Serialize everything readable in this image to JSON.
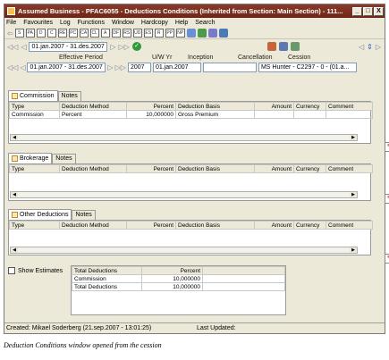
{
  "window": {
    "title": "Assumed Business - PFAC6055 - Deductions Conditions (Inherited from Section: Main Section) - 111...",
    "min_label": "_",
    "max_label": "□",
    "close_label": "X"
  },
  "menu": [
    "File",
    "Favourites",
    "Log",
    "Functions",
    "Window",
    "Hardcopy",
    "Help",
    "Search"
  ],
  "toolbar_icons": [
    "S",
    "PA",
    "D",
    "C",
    "RE",
    "PC",
    "CA",
    "CL",
    "A",
    "DF",
    "RS",
    "UD",
    "ES",
    "R",
    "PP",
    "NP"
  ],
  "navigation": {
    "period_value": "01.jan.2007 - 31.des.2007"
  },
  "contract": {
    "headers": {
      "effective_period": "Effective Period",
      "uw_yr": "U/W Yr",
      "inception": "Inception",
      "cancellation": "Cancellation",
      "cession": "Cession"
    },
    "values": {
      "effective_period": "01.jan.2007 - 31.des.2007",
      "uw_yr": "2007",
      "inception": "01.jan.2007",
      "cancellation": "",
      "cession": "MS Hunter - C2297 - 0 - (01.a..."
    }
  },
  "commission": {
    "tab": "Commission",
    "notes_tab": "Notes",
    "columns": [
      "Type",
      "Deduction Method",
      "Percent",
      "Deduction Basis",
      "Amount",
      "Currency",
      "Comment"
    ],
    "rows": [
      [
        "Commission",
        "Percent",
        "10,000000",
        "Gross Premium",
        "",
        "",
        ""
      ]
    ]
  },
  "brokerage": {
    "tab": "Brokerage",
    "notes_tab": "Notes",
    "columns": [
      "Type",
      "Deduction Method",
      "Percent",
      "Deduction Basis",
      "Amount",
      "Currency",
      "Comment"
    ]
  },
  "other": {
    "tab": "Other Deductions",
    "notes_tab": "Notes",
    "columns": [
      "Type",
      "Deduction Method",
      "Percent",
      "Deduction Basis",
      "Amount",
      "Currency",
      "Comment"
    ]
  },
  "estimates": {
    "checkbox_label": "Show Estimates",
    "columns": [
      "Total Deductions",
      "Percent"
    ],
    "rows": [
      [
        "Commission",
        "10,000000"
      ],
      [
        "Total Deductions",
        "10,000000"
      ]
    ]
  },
  "status": {
    "created": "Created: Mikael Soderberg (21.sep.2007 - 13:01:25)",
    "updated": "Last Updated:"
  },
  "caption": "Deduction Conditions window opened from the cession"
}
